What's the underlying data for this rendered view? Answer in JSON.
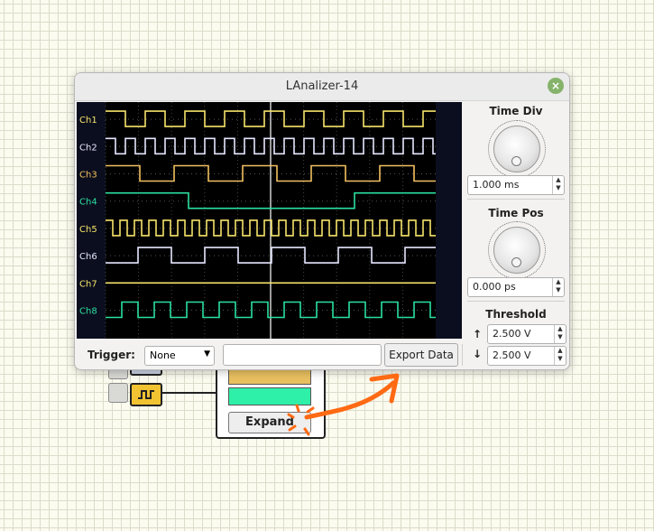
{
  "window": {
    "title": "LAnalizer-14"
  },
  "background": {
    "expand_label": "Expand",
    "bar_colors": [
      "#e9c060",
      "#2ef0a9"
    ]
  },
  "channels": [
    {
      "label": "Ch1",
      "color": "#f6e36a",
      "type": "square",
      "period": 44,
      "phase": 0
    },
    {
      "label": "Ch2",
      "color": "#e6e6ff",
      "type": "square",
      "period": 22,
      "phase": 0
    },
    {
      "label": "Ch3",
      "color": "#f2c060",
      "type": "square",
      "period": 76,
      "phase": 0
    },
    {
      "label": "Ch4",
      "color": "#2be0a0",
      "type": "step",
      "edges": [
        92,
        276
      ]
    },
    {
      "label": "Ch5",
      "color": "#f6e36a",
      "type": "square",
      "period": 16,
      "phase": 0
    },
    {
      "label": "Ch6",
      "color": "#e6e6ff",
      "type": "square",
      "period": 74,
      "phase": 36
    },
    {
      "label": "Ch7",
      "color": "#f6e36a",
      "type": "flat"
    },
    {
      "label": "Ch8",
      "color": "#2be0a0",
      "type": "square",
      "period": 36,
      "phase": 18
    }
  ],
  "controls": {
    "time_div": {
      "title": "Time Div",
      "value": "1.000 ms"
    },
    "time_pos": {
      "title": "Time Pos",
      "value": "0.000 ps"
    },
    "threshold": {
      "title": "Threshold",
      "up_value": "2.500 V",
      "down_value": "2.500 V"
    }
  },
  "trigger": {
    "label": "Trigger:",
    "selected": "None"
  },
  "export_button": "Export Data",
  "colors": {
    "scope_bg": "#0b0e1e",
    "annotation": "#ff6a13"
  }
}
